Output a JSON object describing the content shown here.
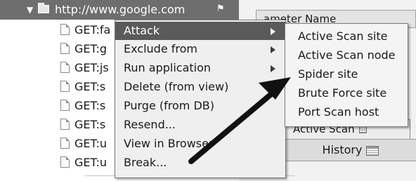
{
  "tree": {
    "root_label": "http://www.google.com",
    "root_flag": "⚑",
    "twisty": "▼",
    "nodes": [
      {
        "label": "GET:fa"
      },
      {
        "label": "GET:g"
      },
      {
        "label": "GET:js"
      },
      {
        "label": "GET:s"
      },
      {
        "label": "GET:s"
      },
      {
        "label": "GET:s"
      },
      {
        "label": "GET:u"
      },
      {
        "label": "GET:u"
      }
    ]
  },
  "params": {
    "header": "ameter Name"
  },
  "tabs": {
    "active_scan": "Active Scan",
    "history": "History"
  },
  "context_menu": {
    "items": [
      {
        "label": "Attack",
        "submenu": true,
        "highlighted": true
      },
      {
        "label": "Exclude from",
        "submenu": true,
        "highlighted": false
      },
      {
        "label": "Run application",
        "submenu": true,
        "highlighted": false
      },
      {
        "label": "Delete (from view)",
        "submenu": false,
        "highlighted": false
      },
      {
        "label": "Purge (from DB)",
        "submenu": false,
        "highlighted": false
      },
      {
        "label": "Resend...",
        "submenu": false,
        "highlighted": false
      },
      {
        "label": "View in Browser",
        "submenu": false,
        "highlighted": false
      },
      {
        "label": "Break...",
        "submenu": false,
        "highlighted": false
      }
    ]
  },
  "attack_submenu": {
    "items": [
      {
        "label": "Active Scan site"
      },
      {
        "label": "Active Scan node"
      },
      {
        "label": "Spider site"
      },
      {
        "label": "Brute Force site"
      },
      {
        "label": "Port Scan host"
      }
    ]
  },
  "colors": {
    "menu_highlight": "#5a5a5a",
    "tree_selection": "#6e6e6e",
    "annotation_arrow": "#111111"
  },
  "icons": {
    "folder": "folder-icon",
    "document": "document-icon",
    "submenu_arrow": "submenu-arrow-icon",
    "history": "history-icon",
    "annotation": "annotation-arrow"
  }
}
